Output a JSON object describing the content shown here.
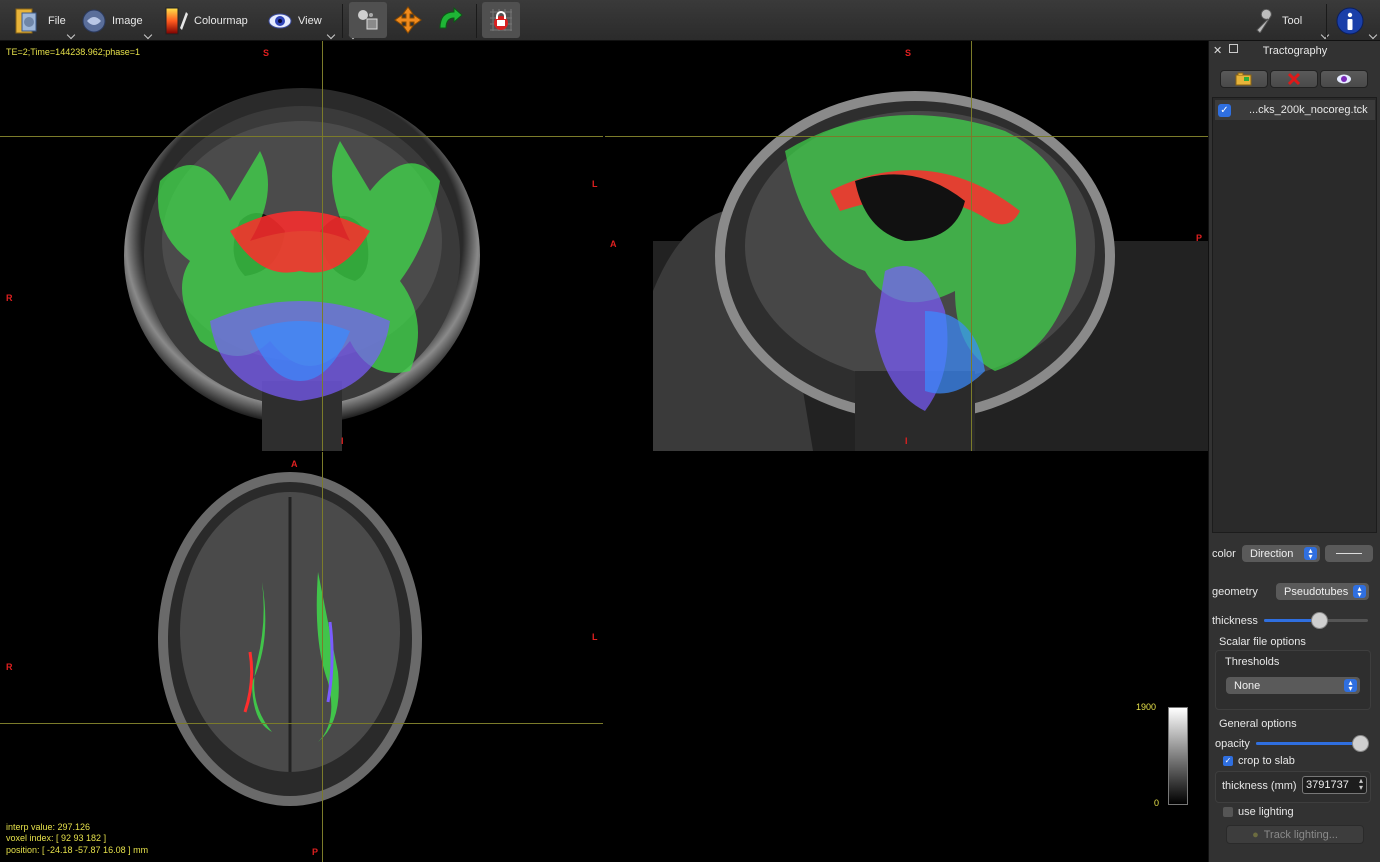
{
  "toolbar": {
    "file_label": "File",
    "image_label": "Image",
    "colourmap_label": "Colourmap",
    "view_label": "View",
    "tool_label": "Tool",
    "icons": [
      "folder-icon",
      "brain-image-icon",
      "colourmap-icon",
      "eye-icon",
      "pan-zoom-icon",
      "move-icon",
      "rotate-icon",
      "lock-icon",
      "wrench-icon",
      "info-icon"
    ]
  },
  "viewer": {
    "header_info": "TE=2;Time=144238.962;phase=1",
    "interp_value": "interp value: 297.126",
    "voxel_index": "voxel index: [ 92 93 182 ]",
    "position": "position: [ -24.18 -57.87 16.08 ] mm",
    "orientation": {
      "coronal": {
        "top": "S",
        "left": "R",
        "right": "L",
        "bottom": "I"
      },
      "sagittal": {
        "top": "S",
        "left": "A",
        "right": "P",
        "bottom": "I"
      },
      "axial": {
        "top": "A",
        "left": "R",
        "right": "L",
        "bottom": "P"
      }
    },
    "colorbar": {
      "max": "1900",
      "min": "0"
    }
  },
  "dock": {
    "title": "Tractography",
    "track_file": "...cks_200k_nocoreg.tck",
    "track_checked": true,
    "color_label": "color",
    "color_value": "Direction",
    "geometry_label": "geometry",
    "geometry_value": "Pseudotubes",
    "thickness_label": "thickness",
    "thickness_level": 0.57,
    "scalar_group_title": "Scalar file options",
    "thresholds_title": "Thresholds",
    "thresholds_value": "None",
    "general_group_title": "General options",
    "opacity_label": "opacity",
    "opacity_level": 1.0,
    "crop_label": "crop to slab",
    "crop_checked": true,
    "slab_thickness_label": "thickness (mm)",
    "slab_thickness_value": "3791737",
    "lighting_label": "use lighting",
    "lighting_checked": false,
    "track_lighting_label": "Track lighting...",
    "accent_color": "#2f6fe0"
  }
}
